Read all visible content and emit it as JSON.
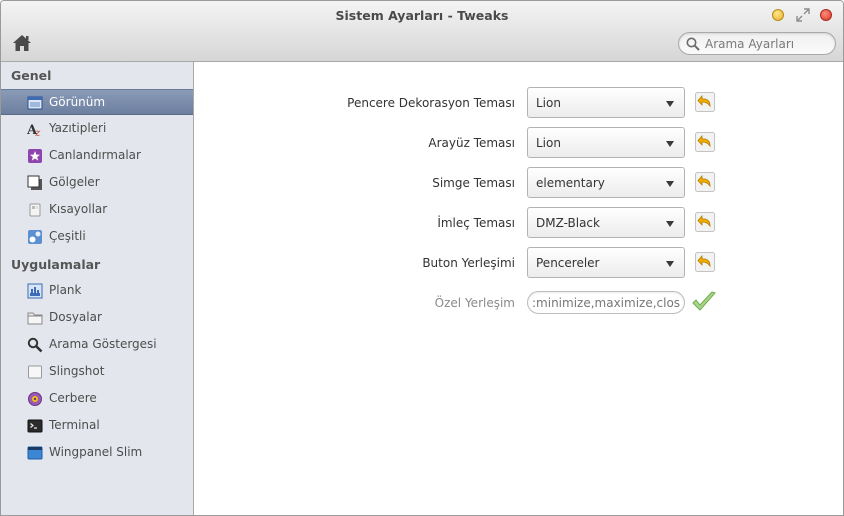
{
  "window": {
    "title": "Sistem Ayarları - Tweaks"
  },
  "toolbar": {
    "home_icon": "home-icon",
    "search_placeholder": "Arama Ayarları"
  },
  "sidebar": {
    "categories": [
      {
        "label": "Genel",
        "items": [
          {
            "label": "Görünüm",
            "icon": "appearance-icon",
            "selected": true
          },
          {
            "label": "Yazıtipleri",
            "icon": "fonts-icon"
          },
          {
            "label": "Canlandırmalar",
            "icon": "animations-icon"
          },
          {
            "label": "Gölgeler",
            "icon": "shadows-icon"
          },
          {
            "label": "Kısayollar",
            "icon": "shortcuts-icon"
          },
          {
            "label": "Çeşitli",
            "icon": "misc-icon"
          }
        ]
      },
      {
        "label": "Uygulamalar",
        "items": [
          {
            "label": "Plank",
            "icon": "plank-icon"
          },
          {
            "label": "Dosyalar",
            "icon": "folder-icon"
          },
          {
            "label": "Arama Göstergesi",
            "icon": "search-indicator-icon"
          },
          {
            "label": "Slingshot",
            "icon": "slingshot-icon"
          },
          {
            "label": "Cerbere",
            "icon": "cerbere-icon"
          },
          {
            "label": "Terminal",
            "icon": "terminal-icon"
          },
          {
            "label": "Wingpanel Slim",
            "icon": "wingpanel-icon"
          }
        ]
      }
    ]
  },
  "settings": {
    "rows": [
      {
        "label": "Pencere Dekorasyon Teması",
        "value": "Lion"
      },
      {
        "label": "Arayüz Teması",
        "value": "Lion"
      },
      {
        "label": "Simge Teması",
        "value": "elementary"
      },
      {
        "label": "İmleç Teması",
        "value": "DMZ-Black"
      },
      {
        "label": "Buton Yerleşimi",
        "value": "Pencereler"
      }
    ],
    "custom": {
      "label": "Özel Yerleşim",
      "value": ":minimize,maximize,close"
    }
  },
  "colors": {
    "selection": "#7a8cab",
    "sidebar_bg": "#e3e7ed"
  }
}
